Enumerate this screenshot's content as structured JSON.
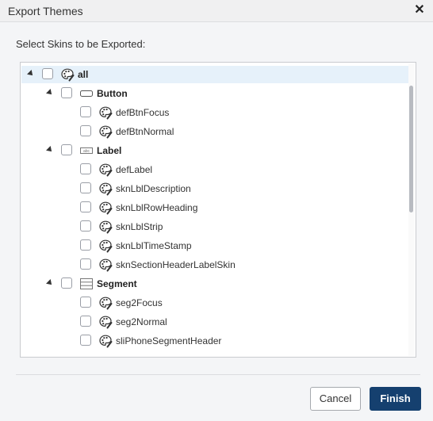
{
  "dialog": {
    "title": "Export Themes",
    "close_glyph": "✕",
    "instruction": "Select Skins to be Exported:",
    "cancel_label": "Cancel",
    "finish_label": "Finish"
  },
  "colors": {
    "accent": "#15406f",
    "selection": "#e6f1fa"
  },
  "tree": {
    "rows": [
      {
        "label": "all",
        "icon": "palette-icon",
        "level": 0,
        "expanded": true,
        "selected": true
      },
      {
        "label": "Button",
        "icon": "button-widget-icon",
        "level": 1,
        "expanded": true
      },
      {
        "label": "defBtnFocus",
        "icon": "palette-icon",
        "level": 2
      },
      {
        "label": "defBtnNormal",
        "icon": "palette-icon",
        "level": 2
      },
      {
        "label": "Label",
        "icon": "label-widget-icon",
        "level": 1,
        "expanded": true
      },
      {
        "label": "defLabel",
        "icon": "palette-icon",
        "level": 2
      },
      {
        "label": "sknLblDescription",
        "icon": "palette-icon",
        "level": 2
      },
      {
        "label": "sknLblRowHeading",
        "icon": "palette-icon",
        "level": 2
      },
      {
        "label": "sknLblStrip",
        "icon": "palette-icon",
        "level": 2
      },
      {
        "label": "sknLblTimeStamp",
        "icon": "palette-icon",
        "level": 2
      },
      {
        "label": "sknSectionHeaderLabelSkin",
        "icon": "palette-icon",
        "level": 2
      },
      {
        "label": "Segment",
        "icon": "segment-widget-icon",
        "level": 1,
        "expanded": true
      },
      {
        "label": "seg2Focus",
        "icon": "palette-icon",
        "level": 2
      },
      {
        "label": "seg2Normal",
        "icon": "palette-icon",
        "level": 2
      },
      {
        "label": "sliPhoneSegmentHeader",
        "icon": "palette-icon",
        "level": 2
      }
    ]
  }
}
